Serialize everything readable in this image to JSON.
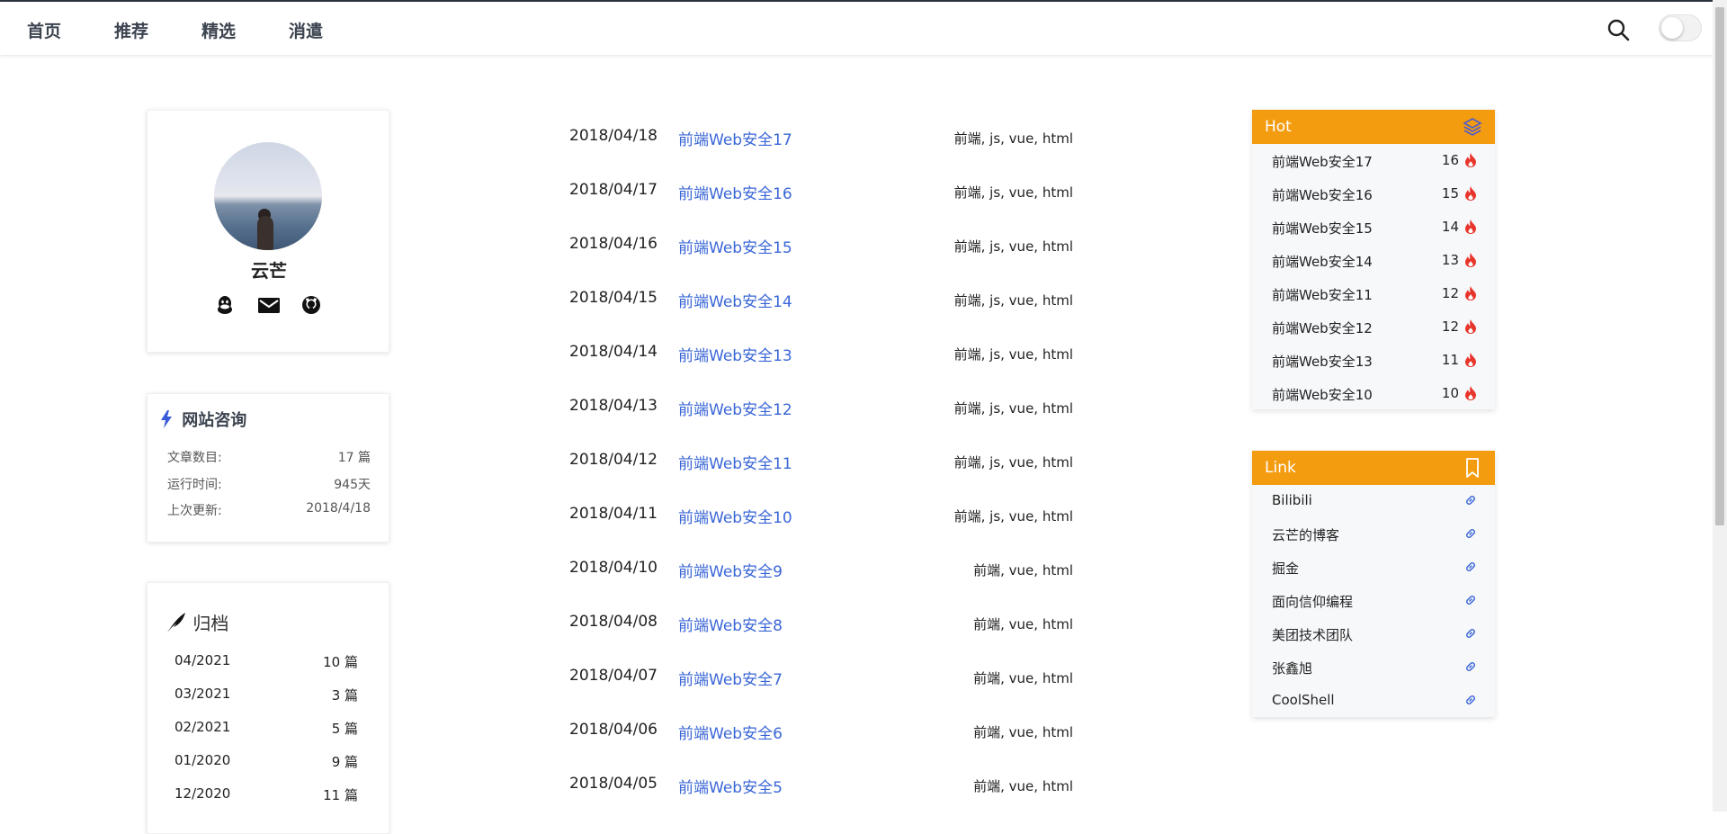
{
  "nav": {
    "items": [
      "首页",
      "推荐",
      "精选",
      "消遣"
    ]
  },
  "profile": {
    "name": "云芒",
    "social_icons": [
      "qq-icon",
      "mail-icon",
      "github-icon"
    ]
  },
  "site_info": {
    "title": "网站咨询",
    "rows": [
      {
        "label": "文章数目:",
        "value": "17 篇"
      },
      {
        "label": "运行时间:",
        "value": "945天"
      },
      {
        "label": "上次更新:",
        "value": "2018/4/18"
      }
    ]
  },
  "archive": {
    "title": "归档",
    "rows": [
      {
        "month": "04/2021",
        "count": "10 篇"
      },
      {
        "month": "03/2021",
        "count": "3 篇"
      },
      {
        "month": "02/2021",
        "count": "5 篇"
      },
      {
        "month": "01/2020",
        "count": "9 篇"
      },
      {
        "month": "12/2020",
        "count": "11 篇"
      }
    ]
  },
  "posts": [
    {
      "date": "2018/04/18",
      "title": "前端Web安全17",
      "tags": "前端, js, vue, html"
    },
    {
      "date": "2018/04/17",
      "title": "前端Web安全16",
      "tags": "前端, js, vue, html"
    },
    {
      "date": "2018/04/16",
      "title": "前端Web安全15",
      "tags": "前端, js, vue, html"
    },
    {
      "date": "2018/04/15",
      "title": "前端Web安全14",
      "tags": "前端, js, vue, html"
    },
    {
      "date": "2018/04/14",
      "title": "前端Web安全13",
      "tags": "前端, js, vue, html"
    },
    {
      "date": "2018/04/13",
      "title": "前端Web安全12",
      "tags": "前端, js, vue, html"
    },
    {
      "date": "2018/04/12",
      "title": "前端Web安全11",
      "tags": "前端, js, vue, html"
    },
    {
      "date": "2018/04/11",
      "title": "前端Web安全10",
      "tags": "前端, js, vue, html"
    },
    {
      "date": "2018/04/10",
      "title": "前端Web安全9",
      "tags": "前端, vue, html"
    },
    {
      "date": "2018/04/08",
      "title": "前端Web安全8",
      "tags": "前端, vue, html"
    },
    {
      "date": "2018/04/07",
      "title": "前端Web安全7",
      "tags": "前端, vue, html"
    },
    {
      "date": "2018/04/06",
      "title": "前端Web安全6",
      "tags": "前端, vue, html"
    },
    {
      "date": "2018/04/05",
      "title": "前端Web安全5",
      "tags": "前端, vue, html"
    }
  ],
  "hot": {
    "title": "Hot",
    "icon": "layers-icon",
    "rows": [
      {
        "title": "前端Web安全17",
        "count": "16"
      },
      {
        "title": "前端Web安全16",
        "count": "15"
      },
      {
        "title": "前端Web安全15",
        "count": "14"
      },
      {
        "title": "前端Web安全14",
        "count": "13"
      },
      {
        "title": "前端Web安全11",
        "count": "12"
      },
      {
        "title": "前端Web安全12",
        "count": "12"
      },
      {
        "title": "前端Web安全13",
        "count": "11"
      },
      {
        "title": "前端Web安全10",
        "count": "10"
      }
    ]
  },
  "links": {
    "title": "Link",
    "icon": "bookmark-icon",
    "rows": [
      "Bilibili",
      "云芒的博客",
      "掘金",
      "面向信仰编程",
      "美团技术团队",
      "张鑫旭",
      "CoolShell"
    ]
  },
  "colors": {
    "accent": "#f39c10",
    "link": "#3a66d6",
    "fire": "#e8352b"
  }
}
